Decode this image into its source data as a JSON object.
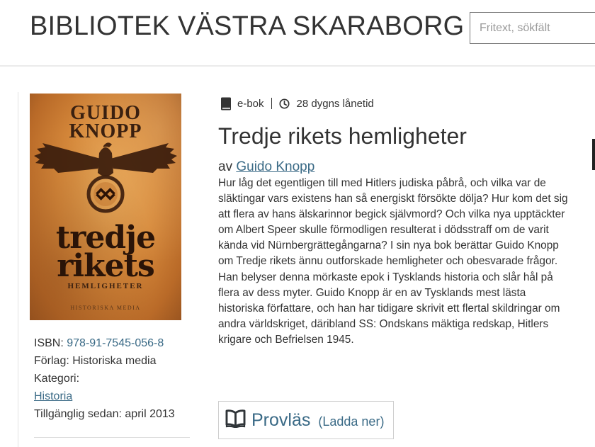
{
  "header": {
    "site_title": "BIBLIOTEK VÄSTRA SKARABORG",
    "search": {
      "placeholder": "Fritext, sökfält",
      "value": ""
    }
  },
  "cover": {
    "author_line1": "GUIDO",
    "author_line2": "KNOPP",
    "title_line1": "tredje",
    "title_line2": "rikets",
    "subtitle": "HEMLIGHETER",
    "publisher": "HISTORISKA MEDIA",
    "colors": {
      "paper": "#d6893b",
      "ink": "#3a2010"
    }
  },
  "metadata": {
    "isbn_label": "ISBN:",
    "isbn_value": "978-91-7545-056-8",
    "publisher_label": "Förlag:",
    "publisher_value": "Historiska media",
    "category_label": "Kategori:",
    "category_value": "Historia",
    "available_label": "Tillgänglig sedan:",
    "available_value": "april 2013"
  },
  "badges": {
    "format_icon": "book-icon",
    "format": "e-bok",
    "loan_icon": "clock-icon",
    "loan_period": "28 dygns lånetid"
  },
  "book": {
    "title": "Tredje rikets hemligheter",
    "by_prefix": "av",
    "author": "Guido Knopp",
    "description": "Hur låg det egentligen till med Hitlers judiska påbrå, och vilka var de släktingar vars existens han så energiskt försökte dölja? Hur kom det sig att flera av hans älskarinnor begick självmord? Och vilka nya upptäckter om Albert Speer skulle förmodligen resulterat i dödsstraff om de varit kända vid Nürnbergrättegångarna? I sin nya bok berättar Guido Knopp om Tredje rikets ännu outforskade hemligheter och obesvarade frågor. Han belyser denna mörkaste epok i Tysklands historia och slår hål på flera av dess myter. Guido Knopp är en av Tysklands mest lästa historiska författare, och han har tidigare skrivit ett flertal skildringar om andra världskriget, däribland SS: Ondskans mäktiga redskap, Hitlers krigare och Befrielsen 1945."
  },
  "preview": {
    "icon": "open-book-icon",
    "label": "Provläs",
    "sub_label": "(Ladda ner)"
  },
  "colors": {
    "link": "#3a6a86",
    "text": "#333333",
    "divider": "#ebebeb"
  }
}
